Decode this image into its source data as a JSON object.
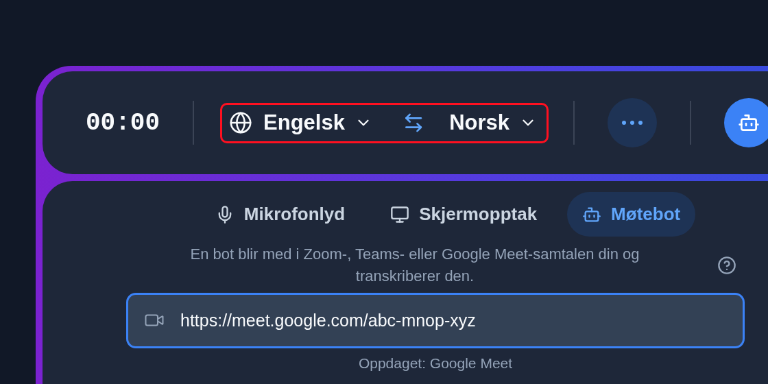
{
  "top_bar": {
    "timer": "00:00",
    "language_picker": {
      "highlighted": true,
      "source": "Engelsk",
      "target": "Norsk"
    }
  },
  "tabs": [
    {
      "label": "Mikrofonlyd",
      "kind": "mic",
      "selected": false
    },
    {
      "label": "Skjermopptak",
      "kind": "screen",
      "selected": false
    },
    {
      "label": "Møtebot",
      "kind": "bot",
      "selected": true
    }
  ],
  "description": "En bot blir med i Zoom-, Teams- eller Google Meet-samtalen din og transkriberer den.",
  "meeting_link": {
    "value": "https://meet.google.com/abc-mnop-xyz"
  },
  "detected": "Oppdaget: Google Meet"
}
